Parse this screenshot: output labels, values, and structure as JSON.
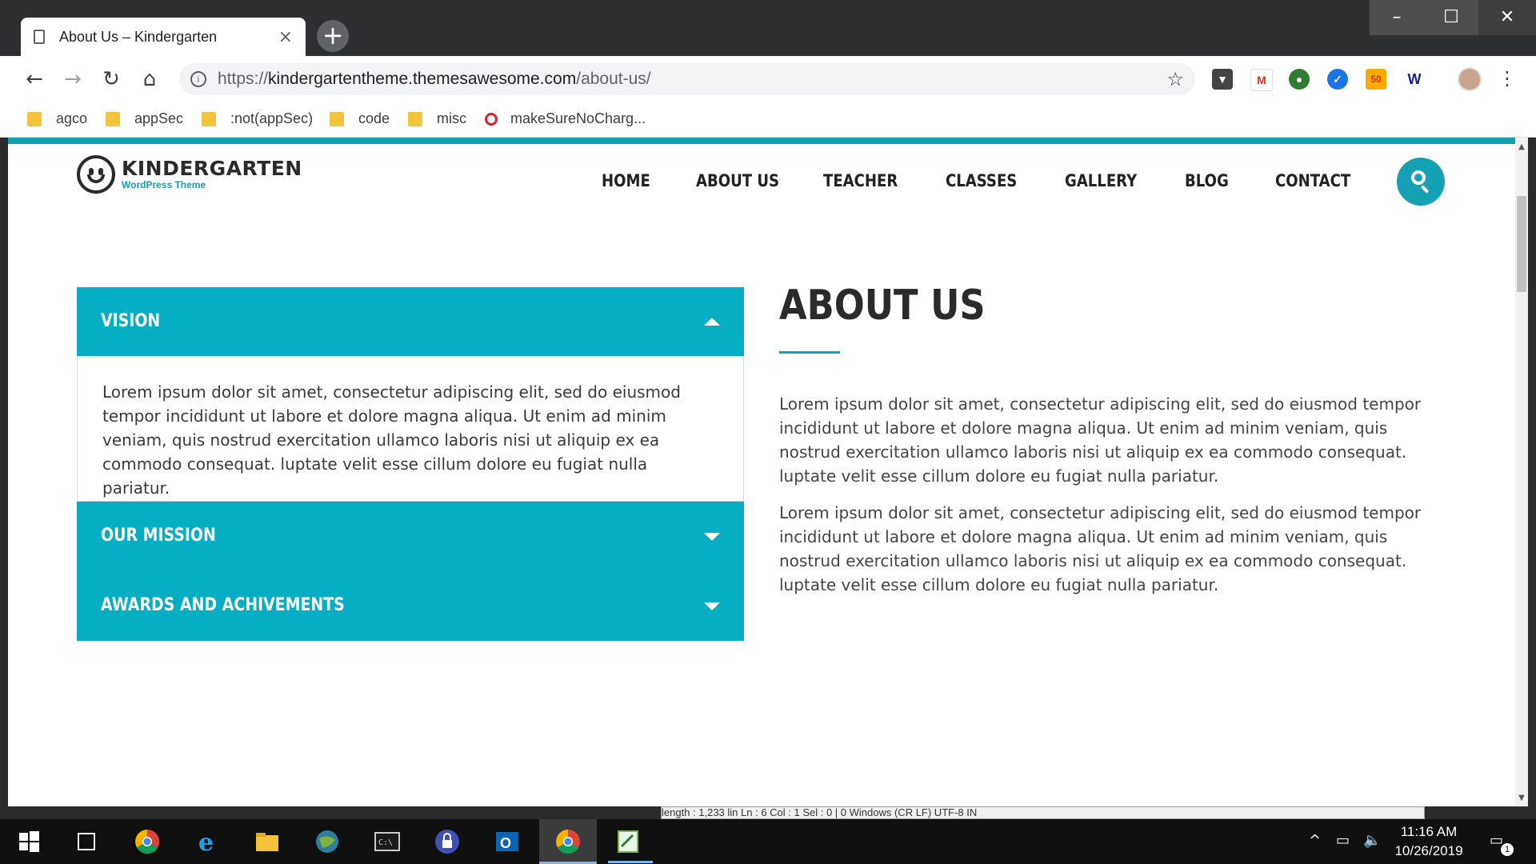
{
  "browser": {
    "tab_title": "About Us – Kindergarten",
    "tab_close": "×",
    "new_tab": "+",
    "url_prefix": "https://",
    "url_host": "kindergartentheme.themesawesome.com",
    "url_path": "/about-us/",
    "bookmarks": [
      "agco",
      "appSec",
      ":not(appSec)",
      "code",
      "misc",
      "makeSureNoCharg..."
    ],
    "extensions": [
      "pocket-icon",
      "gmail-icon",
      "globe-icon",
      "check-icon",
      "badge-icon",
      "w-icon"
    ],
    "badge_count": "50",
    "w_label": "W",
    "window_controls": {
      "minimize": "–",
      "maximize": "☐",
      "close": "✕"
    }
  },
  "site": {
    "logo_title": "KINDERGARTEN",
    "logo_subtitle": "WordPress Theme",
    "nav": [
      "HOME",
      "ABOUT US",
      "TEACHER",
      "CLASSES",
      "GALLERY",
      "BLOG",
      "CONTACT"
    ],
    "accent_color": "#14a1b3",
    "accordion": [
      {
        "title": "VISION",
        "expanded": true,
        "body": "Lorem ipsum dolor sit amet, consectetur adipiscing elit, sed do eiusmod tempor incididunt ut labore et dolore magna aliqua. Ut enim ad minim veniam, quis nostrud exercitation ullamco laboris nisi ut aliquip ex ea commodo consequat. luptate velit esse cillum dolore eu fugiat nulla pariatur."
      },
      {
        "title": "OUR MISSION",
        "expanded": false
      },
      {
        "title": "AWARDS AND ACHIVEMENTS",
        "expanded": false
      }
    ],
    "about": {
      "heading": "ABOUT US",
      "paragraphs": [
        "Lorem ipsum dolor sit amet, consectetur adipiscing elit, sed do eiusmod tempor incididunt ut labore et dolore magna aliqua. Ut enim ad minim veniam, quis nostrud exercitation ullamco laboris nisi ut aliquip ex ea commodo consequat. luptate velit esse cillum dolore eu fugiat nulla pariatur.",
        "Lorem ipsum dolor sit amet, consectetur adipiscing elit, sed do eiusmod tempor incididunt ut labore et dolore magna aliqua. Ut enim ad minim veniam, quis nostrud exercitation ullamco laboris nisi ut aliquip ex ea commodo consequat. luptate velit esse cillum dolore eu fugiat nulla pariatur."
      ]
    }
  },
  "background_window_status": "length : 1,233    lin Ln : 6    Col : 1    Sel : 0 | 0                                        Windows (CR LF)      UTF-8                              IN",
  "taskbar": {
    "time": "11:16 AM",
    "date": "10/26/2019",
    "notification_count": "1"
  }
}
